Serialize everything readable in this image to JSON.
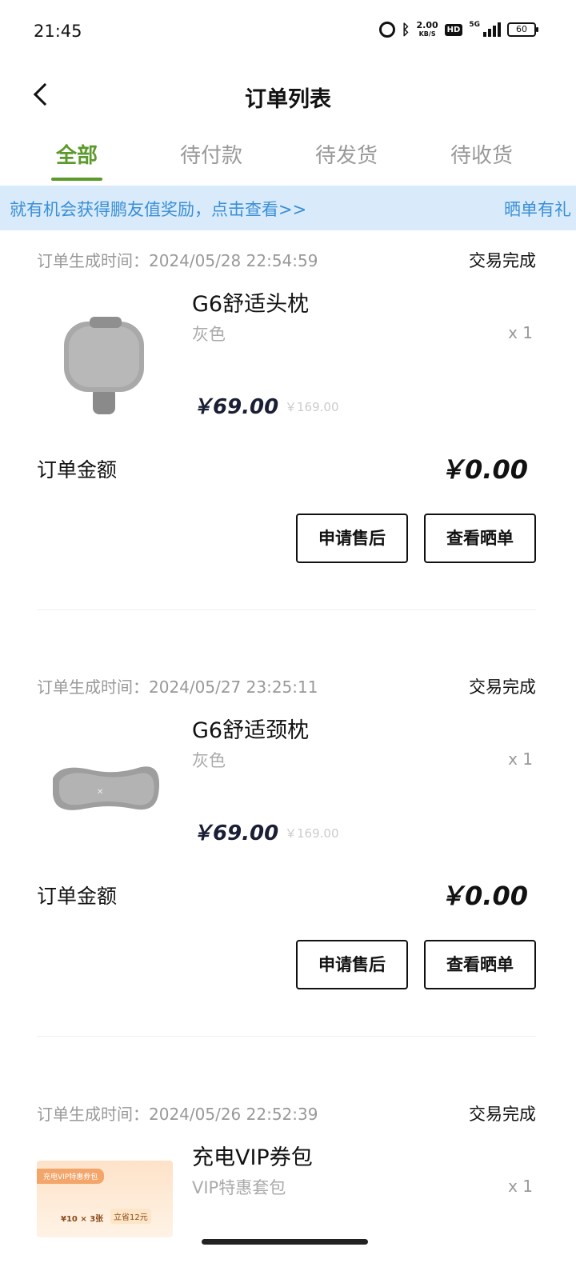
{
  "status_bar": {
    "time": "21:45",
    "speed_top": "2.00",
    "speed_unit": "KB/S",
    "hd": "HD",
    "network": "5G",
    "battery": "60"
  },
  "nav": {
    "title": "订单列表",
    "back_icon": "chevron-left-icon"
  },
  "tabs": [
    {
      "label": "全部",
      "active": true
    },
    {
      "label": "待付款",
      "active": false
    },
    {
      "label": "待发货",
      "active": false
    },
    {
      "label": "待收货",
      "active": false
    }
  ],
  "banner": {
    "text": "就有机会获得鹏友值奖励，点击查看>>",
    "text2": "晒单有礼"
  },
  "orders": [
    {
      "time": "订单生成时间：2024/05/28 22:54:59",
      "status": "交易完成",
      "product": "G6舒适头枕",
      "variant": "灰色",
      "qty": "x 1",
      "price": "￥69.00",
      "original_price": "￥169.00",
      "amount_label": "订单金额",
      "amount": "￥0.00",
      "btn_aftersale": "申请售后",
      "btn_review": "查看晒单"
    },
    {
      "time": "订单生成时间：2024/05/27 23:25:11",
      "status": "交易完成",
      "product": "G6舒适颈枕",
      "variant": "灰色",
      "qty": "x 1",
      "price": "￥69.00",
      "original_price": "￥169.00",
      "amount_label": "订单金额",
      "amount": "￥0.00",
      "btn_aftersale": "申请售后",
      "btn_review": "查看晒单"
    },
    {
      "time": "订单生成时间：2024/05/26 22:52:39",
      "status": "交易完成",
      "product": "充电VIP券包",
      "variant": "VIP特惠套包",
      "qty": "x 1",
      "thumb_title": "充电VIP特惠券包",
      "thumb_count": "¥10 × 3张",
      "thumb_save": "立省12元"
    }
  ],
  "colors": {
    "accent": "#5b9a2b",
    "banner_bg": "#d9ebfb",
    "banner_text": "#3a8fd6"
  }
}
